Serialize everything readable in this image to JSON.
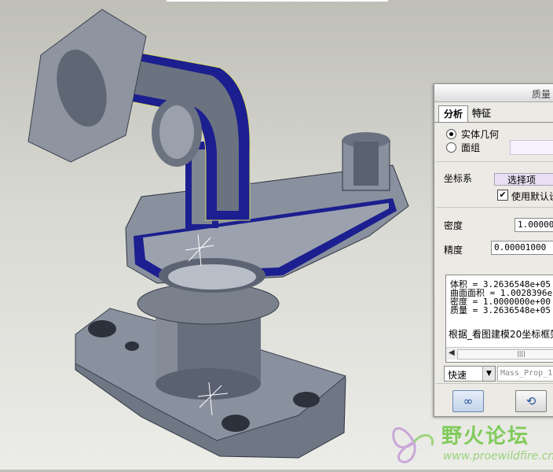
{
  "dialog": {
    "title": "质量",
    "tabs": [
      "分析",
      "特征"
    ],
    "geometry_options": {
      "solid": "实体几何",
      "quilt": "面组",
      "selected": "solid"
    },
    "coord_label": "坐标系",
    "select_button": "选择项",
    "use_default_label": "使用默认设",
    "use_default_checked": true,
    "density_label": "密度",
    "density_value": "1.000000",
    "accuracy_label": "精度",
    "accuracy_value": "0.00001000",
    "results": [
      "体积 =  3.2636548e+05",
      "曲面面积 =  1.0028396e",
      "密度 =  1.0000000e+00",
      "质量 =  3.2636548e+05"
    ],
    "results_note": "根据_看图建模20坐标框架",
    "speed_value": "快速",
    "mass_prop_name": "Mass_Prop_1",
    "colors": {
      "accent": "#4a6fb0"
    }
  },
  "icons": [
    "glasses-icon",
    "refresh-icon"
  ],
  "watermark": {
    "title": "野火论坛",
    "url": "www.proewildfire.cn"
  }
}
